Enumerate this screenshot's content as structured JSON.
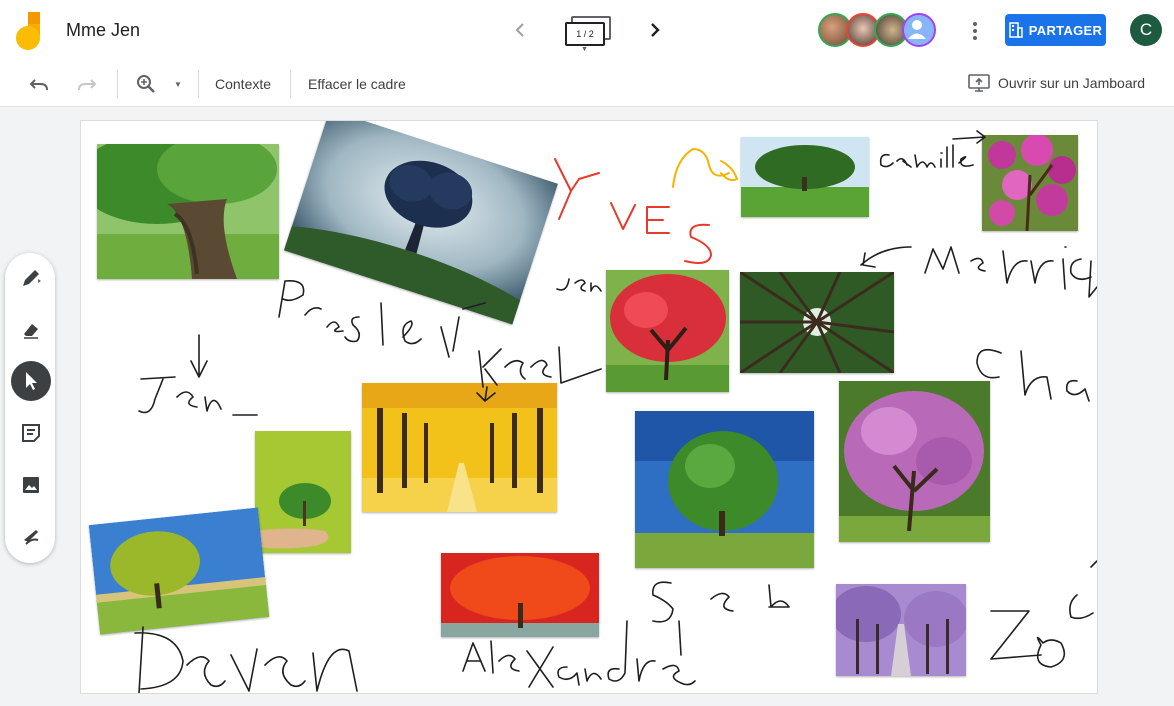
{
  "header": {
    "title": "Mme Jen",
    "frame_indicator": "1 / 2",
    "share_label": "PARTAGER",
    "user_initial": "C"
  },
  "toolbar": {
    "context_label": "Contexte",
    "clear_frame_label": "Effacer le cadre",
    "open_jamboard_label": "Ouvrir sur un Jamboard"
  },
  "collaborators": [
    {
      "name": "collaborator-1",
      "color": "#34a853"
    },
    {
      "name": "collaborator-2",
      "color": "#ea4335"
    },
    {
      "name": "collaborator-3",
      "color": "#34a853"
    },
    {
      "name": "collaborator-4",
      "color": "#a142f4"
    }
  ],
  "side_tools": [
    {
      "name": "pen-tool",
      "active": false
    },
    {
      "name": "eraser-tool",
      "active": false
    },
    {
      "name": "select-tool",
      "active": true
    },
    {
      "name": "sticky-note-tool",
      "active": false
    },
    {
      "name": "image-tool",
      "active": false
    },
    {
      "name": "laser-tool",
      "active": false
    }
  ],
  "canvas": {
    "images": [
      "oak-tree-photo",
      "moon-tree-photo",
      "green-field-tree-photo",
      "pink-magnolia-photo",
      "red-maple-tree-photo",
      "forest-canopy-photo",
      "yellow-avenue-photo",
      "sprout-in-hands-photo",
      "green-tree-blue-sky-photo",
      "purple-redbud-tree-photo",
      "yellow-green-tree-photo",
      "red-autumn-tree-photo",
      "jacaranda-avenue-photo"
    ],
    "handwritten_names": [
      "Yves",
      "camille",
      "Jen",
      "Presley",
      "Jen",
      "Keel",
      "Merrick",
      "Cha",
      "Seb",
      "Devon",
      "Alexandre",
      "Zoe"
    ]
  }
}
